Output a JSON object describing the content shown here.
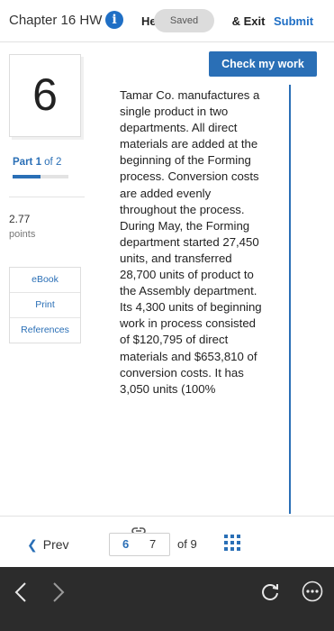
{
  "header": {
    "title": "Chapter 16 HW",
    "info_icon": "i",
    "help_exit_prefix": "He",
    "help_exit_suffix": "& Exit",
    "saved_badge": "Saved",
    "submit_label": "Submit"
  },
  "check_work_label": "Check my work",
  "question": {
    "number": "6",
    "part_label_strong": "Part 1",
    "part_label_rest": " of 2",
    "part_progress": 0.5,
    "points_value": "2.77",
    "points_label": "points",
    "text": "Tamar Co. manufactures a single product in two departments. All direct materials are added at the beginning of the Forming process. Conversion costs are added evenly throughout the process. During May, the Forming department started 27,450 units, and transferred 28,700 units of product to the Assembly department. Its 4,300 units of beginning work in process consisted of $120,795 of direct materials and $653,810 of conversion costs. It has 3,050 units (100%"
  },
  "side_links": [
    "eBook",
    "Print",
    "References"
  ],
  "nav": {
    "prev_label": "Prev",
    "current_page": "6",
    "next_page": "7",
    "total_label": "of 9"
  },
  "icons": {
    "info": "info-icon",
    "link": "link-icon",
    "grid": "grid-icon",
    "back": "chevron-left-icon",
    "forward": "chevron-right-icon",
    "reload": "reload-icon",
    "more": "more-icon"
  },
  "colors": {
    "accent": "#2a6fb6",
    "os_bar": "#2c2c2c"
  }
}
